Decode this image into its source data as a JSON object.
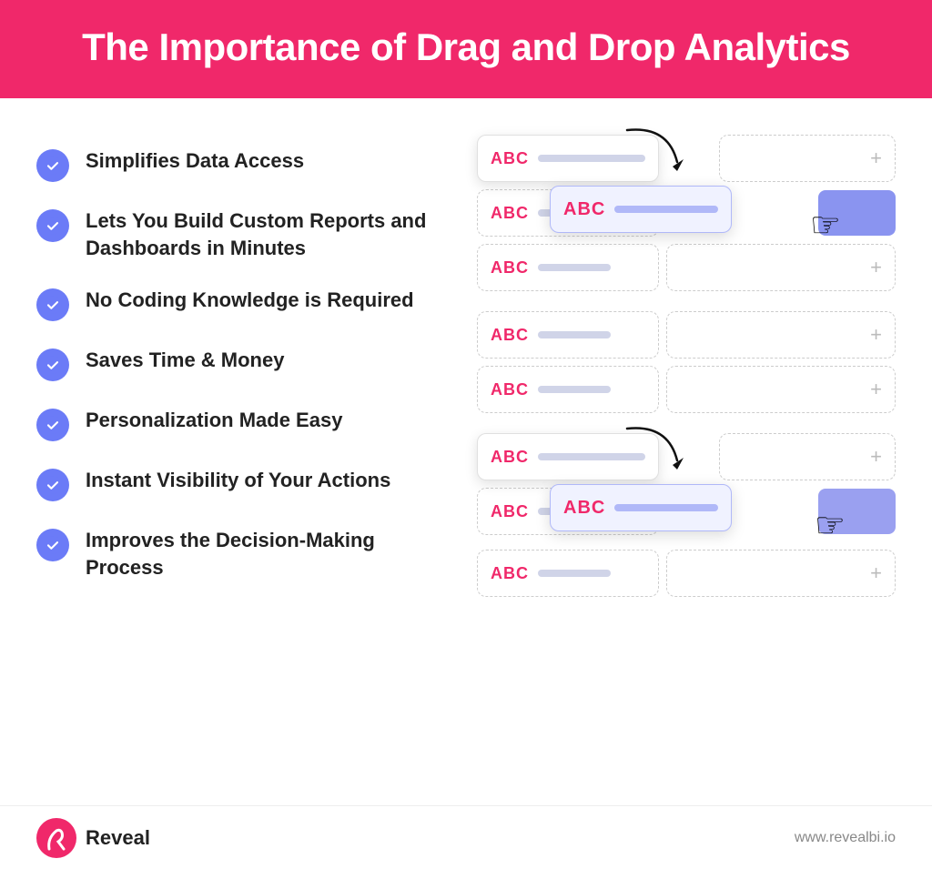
{
  "header": {
    "title": "The Importance of Drag and Drop Analytics"
  },
  "checklist": {
    "items": [
      {
        "id": "simplifies",
        "text": "Simplifies Data Access"
      },
      {
        "id": "custom-reports",
        "text": "Lets You Build Custom Reports and Dashboards in Minutes"
      },
      {
        "id": "no-coding",
        "text": "No Coding Knowledge is Required"
      },
      {
        "id": "saves-time",
        "text": "Saves Time & Money"
      },
      {
        "id": "personalization",
        "text": "Personalization Made Easy"
      },
      {
        "id": "instant-visibility",
        "text": "Instant Visibility of Your Actions"
      },
      {
        "id": "decision-making",
        "text": "Improves the Decision-Making Process"
      }
    ]
  },
  "illustration": {
    "abc_label": "ABC",
    "plus_symbol": "+"
  },
  "footer": {
    "logo_text": "Reveal",
    "website": "www.revealbi.io"
  }
}
